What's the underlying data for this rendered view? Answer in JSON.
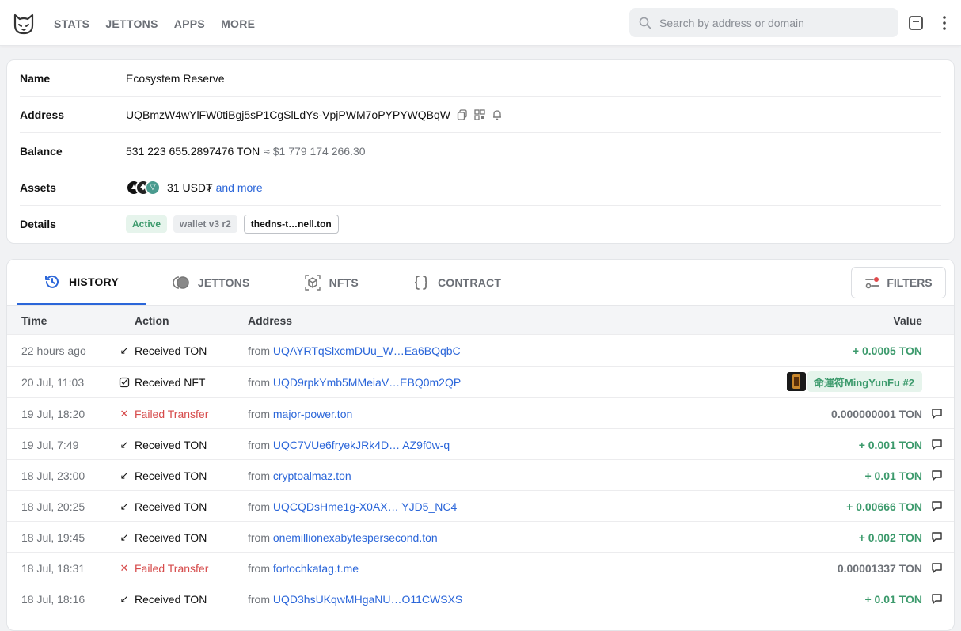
{
  "nav": {
    "items": [
      "STATS",
      "JETTONS",
      "APPS",
      "MORE"
    ],
    "search_placeholder": "Search by address or domain"
  },
  "info": {
    "name_label": "Name",
    "name_value": "Ecosystem Reserve",
    "address_label": "Address",
    "address_value": "UQBmzW4wYlFW0tiBgj5sP1CgSlLdYs-VpjPWM7oPYPYWQBqW",
    "balance_label": "Balance",
    "balance_ton": "531 223 655.2897476 TON",
    "balance_usd": "≈ $1 779 174 266.30",
    "assets_label": "Assets",
    "assets_amount": "31 USD₮",
    "assets_more": "and more",
    "details_label": "Details",
    "badge_status": "Active",
    "badge_version": "wallet v3 r2",
    "badge_dns": "thedns-t…nell.ton"
  },
  "tabs": [
    "HISTORY",
    "JETTONS",
    "NFTS",
    "CONTRACT"
  ],
  "filters_label": "FILTERS",
  "table": {
    "headers": [
      "Time",
      "Action",
      "Address",
      "Value"
    ],
    "rows": [
      {
        "time": "22 hours ago",
        "action": "Received TON",
        "from": "from",
        "address": "UQAYRTqSlxcmDUu_W…Ea6BQqbC",
        "value": "+ 0.0005 TON"
      },
      {
        "time": "20 Jul, 11:03",
        "action": "Received NFT",
        "from": "from",
        "address": "UQD9rpkYmb5MMeiaV…EBQ0m2QP",
        "value": "命運符MingYunFu #2"
      },
      {
        "time": "19 Jul, 18:20",
        "action": "Failed Transfer",
        "from": "from",
        "address": "major-power.ton",
        "value": "0.000000001 TON"
      },
      {
        "time": "19 Jul, 7:49",
        "action": "Received TON",
        "from": "from",
        "address": "UQC7VUe6fryekJRk4D… AZ9f0w-q",
        "value": "+ 0.001 TON"
      },
      {
        "time": "18 Jul, 23:00",
        "action": "Received TON",
        "from": "from",
        "address": "cryptoalmaz.ton",
        "value": "+ 0.01 TON"
      },
      {
        "time": "18 Jul, 20:25",
        "action": "Received TON",
        "from": "from",
        "address": "UQCQDsHme1g-X0AX… YJD5_NC4",
        "value": "+ 0.00666 TON"
      },
      {
        "time": "18 Jul, 19:45",
        "action": "Received TON",
        "from": "from",
        "address": "onemillionexabytespersecond.ton",
        "value": "+ 0.002 TON"
      },
      {
        "time": "18 Jul, 18:31",
        "action": "Failed Transfer",
        "from": "from",
        "address": "fortochkatag.t.me",
        "value": "0.00001337 TON"
      },
      {
        "time": "18 Jul, 18:16",
        "action": "Received TON",
        "from": "from",
        "address": "UQD3hsUKqwMHgaNU…O11CWSXS",
        "value": "+ 0.01 TON"
      }
    ]
  },
  "colors": {
    "accent": "#2b66d9",
    "positive": "#3c9a6c",
    "negative": "#d64b4b"
  }
}
